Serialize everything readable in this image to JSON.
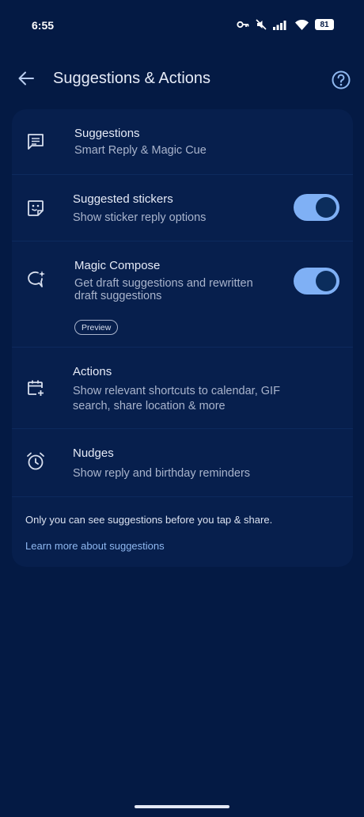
{
  "status_bar": {
    "time": "6:55",
    "battery": "81",
    "icons": [
      "key-icon",
      "mute-icon",
      "signal-icon",
      "wifi-icon",
      "battery-icon"
    ]
  },
  "header": {
    "title": "Suggestions & Actions",
    "back_icon": "arrow-back-icon",
    "help_icon": "help-icon"
  },
  "settings": {
    "suggestions": {
      "title": "Suggestions",
      "subtitle": "Smart Reply & Magic Cue",
      "icon": "message-lines-icon"
    },
    "stickers": {
      "title": "Suggested stickers",
      "subtitle": "Show sticker reply options",
      "icon": "sticker-icon",
      "enabled": true
    },
    "magic_compose": {
      "title": "Magic Compose",
      "subtitle_line1": "Get draft suggestions and rewritten",
      "subtitle_line2": "draft suggestions",
      "badge": "Preview",
      "icon": "sparkle-chat-icon",
      "enabled": true
    },
    "actions": {
      "title": "Actions",
      "subtitle_line1": "Show relevant shortcuts to calendar, GIF",
      "subtitle_line2": "search, share location & more",
      "icon": "calendar-add-icon"
    },
    "nudges": {
      "title": "Nudges",
      "subtitle": "Show reply and birthday reminders",
      "icon": "alarm-icon"
    }
  },
  "footer": {
    "note": "Only you can see suggestions before you tap & share.",
    "link": "Learn more about suggestions"
  },
  "colors": {
    "background": "#041a44",
    "card": "#071f4d",
    "toggle_track": "#7fb0f5",
    "toggle_knob": "#0b2d5c",
    "link": "#8fb8f0"
  }
}
